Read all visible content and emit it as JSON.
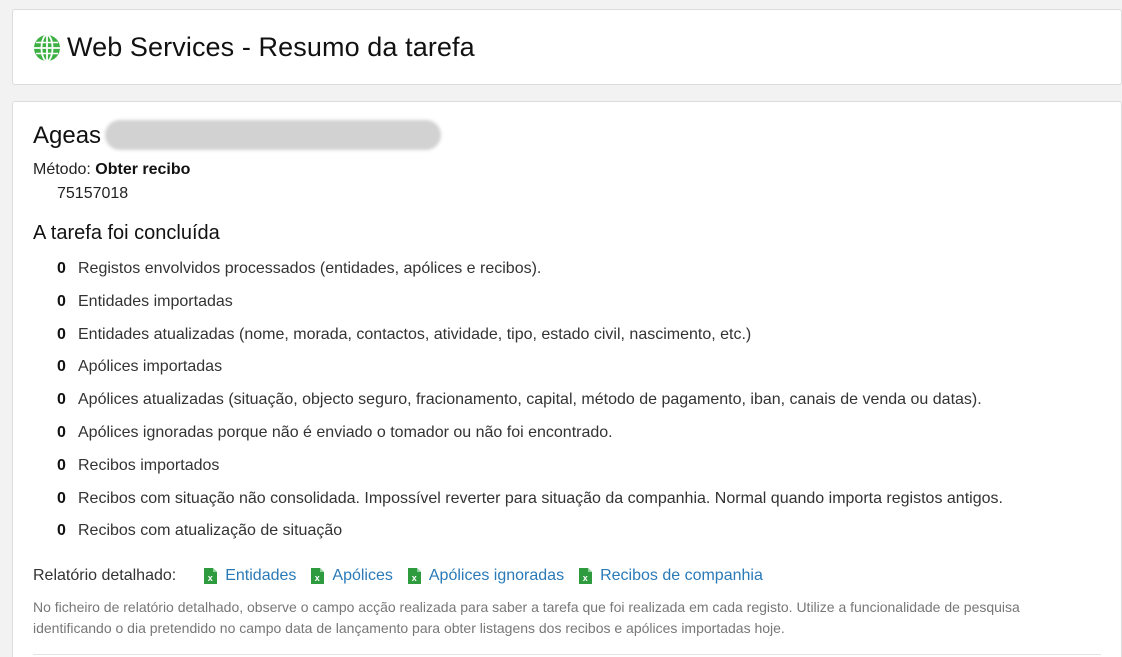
{
  "header": {
    "title": "Web Services - Resumo da tarefa",
    "icon": "globe-icon",
    "icon_color": "#3cb043"
  },
  "entity": {
    "name": "Ageas"
  },
  "method": {
    "label": "Método:",
    "value": "Obter recibo",
    "reference": "75157018"
  },
  "status": {
    "title": "A tarefa foi concluída"
  },
  "stats": [
    {
      "count": "0",
      "desc": "Registos envolvidos processados (entidades, apólices e recibos)."
    },
    {
      "count": "0",
      "desc": "Entidades importadas"
    },
    {
      "count": "0",
      "desc": "Entidades atualizadas (nome, morada, contactos, atividade, tipo, estado civil, nascimento, etc.)"
    },
    {
      "count": "0",
      "desc": "Apólices importadas"
    },
    {
      "count": "0",
      "desc": "Apólices atualizadas (situação, objecto seguro, fracionamento, capital, método de pagamento, iban, canais de venda ou datas)."
    },
    {
      "count": "0",
      "desc": "Apólices ignoradas porque não é enviado o tomador ou não foi encontrado."
    },
    {
      "count": "0",
      "desc": "Recibos importados"
    },
    {
      "count": "0",
      "desc": "Recibos com situação não consolidada. Impossível reverter para situação da companhia. Normal quando importa registos antigos."
    },
    {
      "count": "0",
      "desc": "Recibos com atualização de situação"
    }
  ],
  "report": {
    "label": "Relatório detalhado:",
    "links": [
      {
        "label": "Entidades",
        "icon": "excel-icon"
      },
      {
        "label": "Apólices",
        "icon": "excel-icon"
      },
      {
        "label": "Apólices ignoradas",
        "icon": "excel-icon"
      },
      {
        "label": "Recibos de companhia",
        "icon": "excel-icon"
      }
    ],
    "link_color": "#2a7ab8",
    "icon_color": "#2e9b3f"
  },
  "note": "No ficheiro de relatório detalhado, observe o campo acção realizada para saber a tarefa que foi realizada em cada registo. Utilize a funcionalidade de pesquisa identificando o dia pretendido no campo data de lançamento para obter listagens dos recibos e apólices importadas hoje."
}
